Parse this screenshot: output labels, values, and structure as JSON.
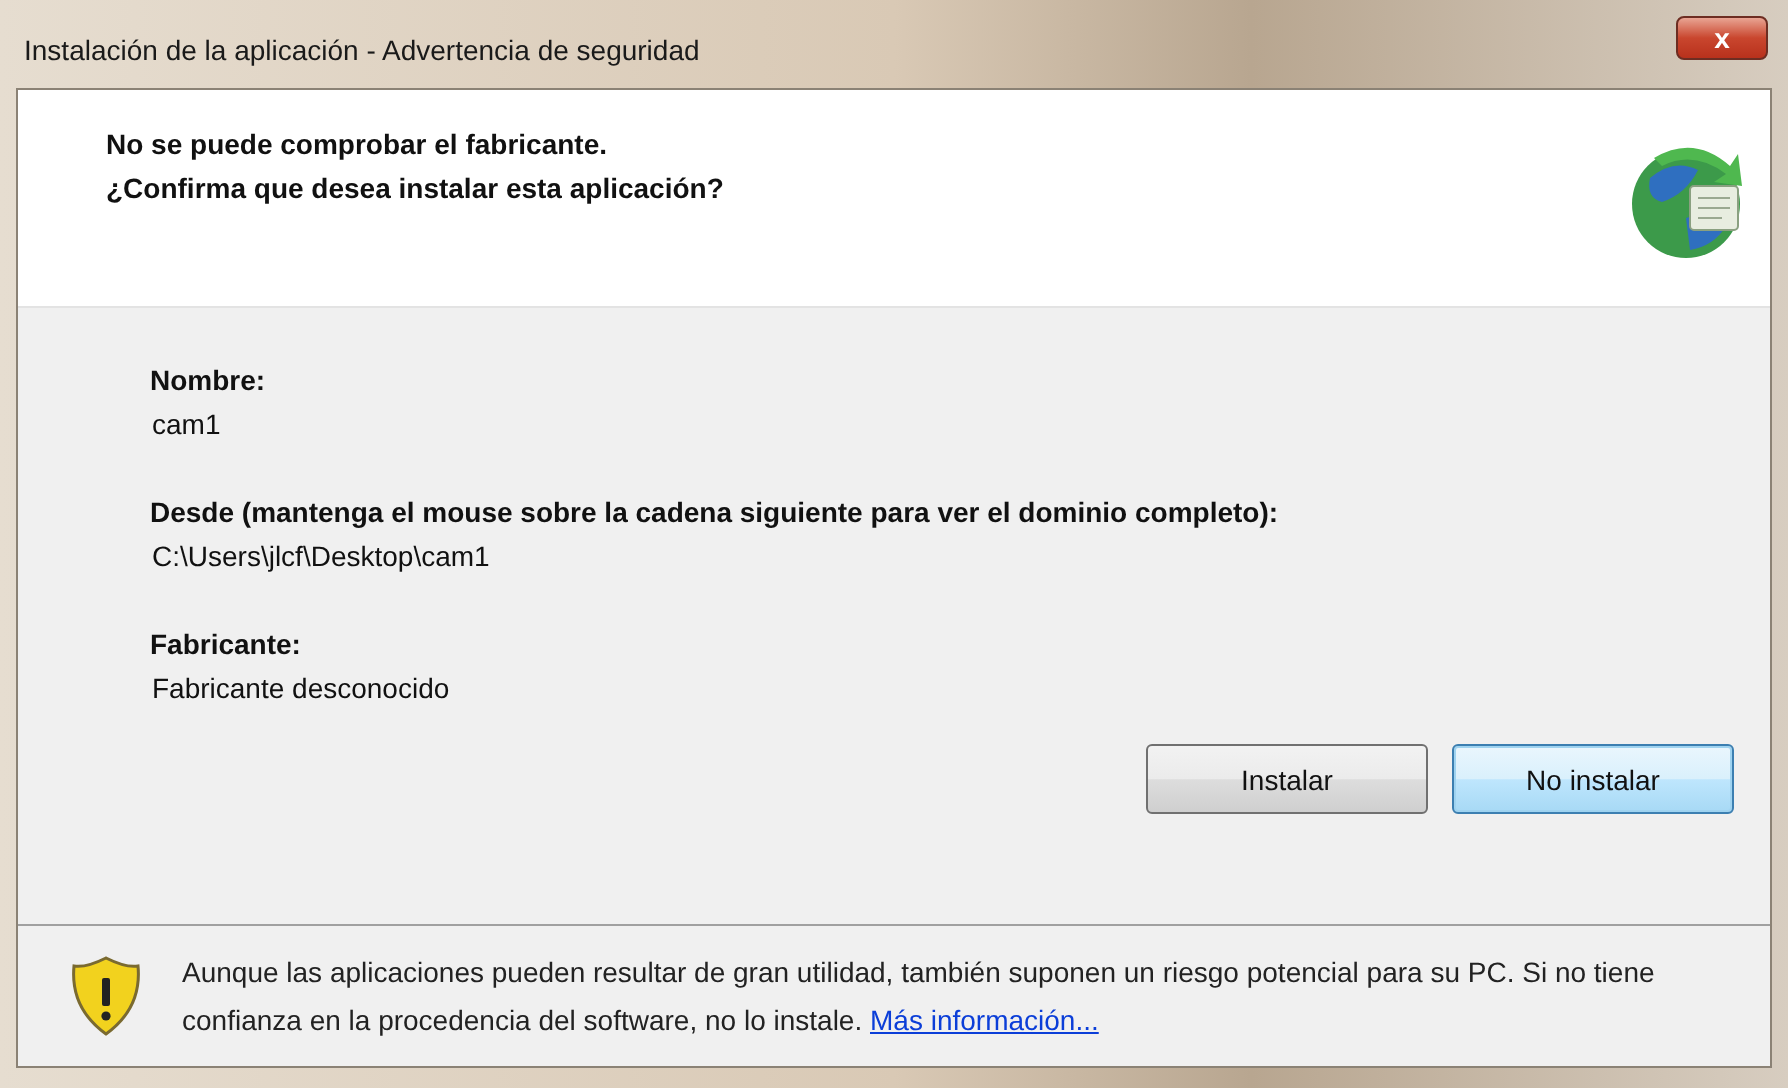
{
  "window": {
    "title": "Instalación de la aplicación - Advertencia de seguridad",
    "close": "x"
  },
  "header": {
    "lines": [
      "No se puede comprobar el fabricante.",
      "¿Confirma que desea instalar esta aplicación?"
    ]
  },
  "fields": [
    {
      "label": "Nombre:",
      "value": "cam1"
    },
    {
      "label": "Desde (mantenga el mouse sobre la cadena siguiente para ver el dominio completo):",
      "value": "C:\\Users\\jlcf\\Desktop\\cam1"
    },
    {
      "label": "Fabricante:",
      "value": "Fabricante desconocido"
    }
  ],
  "buttons": [
    {
      "label": "Instalar",
      "default": false
    },
    {
      "label": "No instalar",
      "default": true
    }
  ],
  "footer": {
    "text": "Aunque las aplicaciones pueden resultar de gran utilidad, también suponen un riesgo potencial para su PC. Si no tiene confianza en la procedencia del software, no lo instale.",
    "link": "Más información..."
  }
}
